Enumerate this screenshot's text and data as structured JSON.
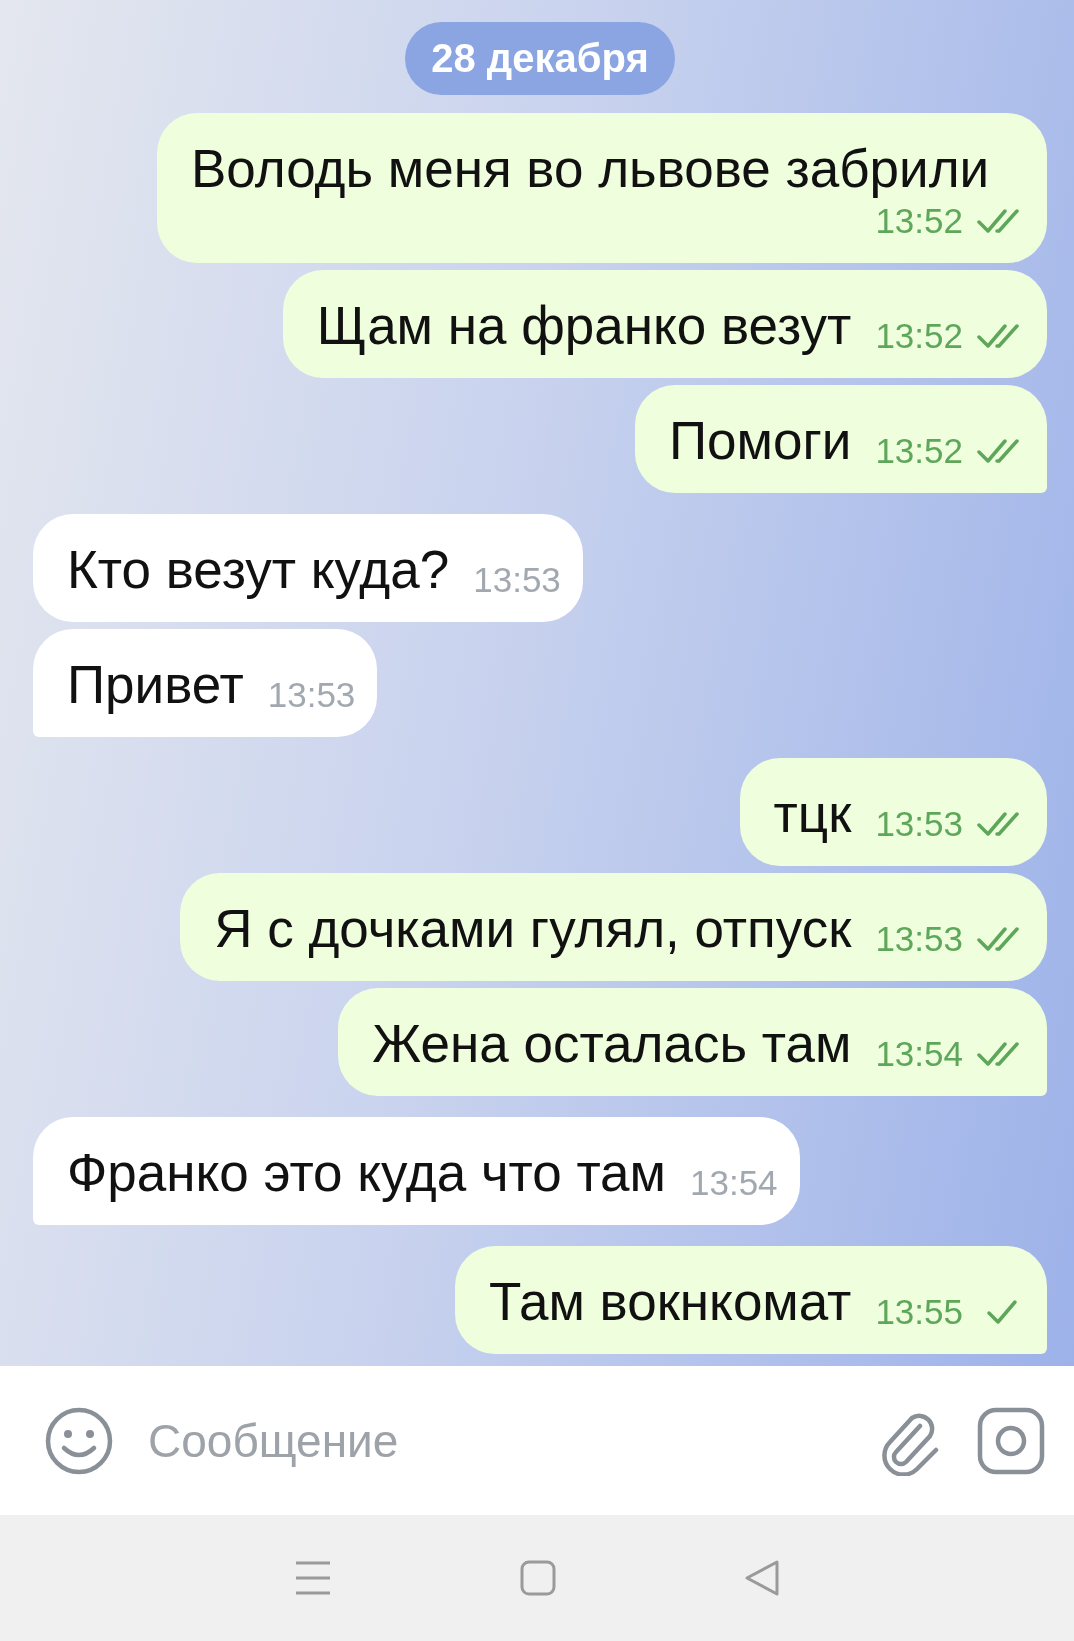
{
  "date_badge": "28 декабря",
  "messages": [
    {
      "kind": "outgoing",
      "text": "Володь меня во львове забрили",
      "time": "13:52",
      "read": true,
      "tail": false
    },
    {
      "kind": "outgoing",
      "text": "Щам на франко везут",
      "time": "13:52",
      "read": true,
      "tail": false
    },
    {
      "kind": "outgoing",
      "text": "Помоги",
      "time": "13:52",
      "read": true,
      "tail": true
    },
    {
      "kind": "incoming",
      "text": "Кто везут куда?",
      "time": "13:53",
      "tail": false
    },
    {
      "kind": "incoming",
      "text": "Привет",
      "time": "13:53",
      "tail": true
    },
    {
      "kind": "outgoing",
      "text": "тцк",
      "time": "13:53",
      "read": true,
      "tail": false
    },
    {
      "kind": "outgoing",
      "text": "Я с дочками гулял, отпуск",
      "time": "13:53",
      "read": true,
      "tail": false
    },
    {
      "kind": "outgoing",
      "text": "Жена осталась там",
      "time": "13:54",
      "read": true,
      "tail": true
    },
    {
      "kind": "incoming",
      "text": "Франко это куда что там",
      "time": "13:54",
      "tail": true
    },
    {
      "kind": "outgoing",
      "text": "Там вокнкомат",
      "time": "13:55",
      "read": false,
      "tail": true
    }
  ],
  "composer": {
    "placeholder": "Сообщение"
  }
}
